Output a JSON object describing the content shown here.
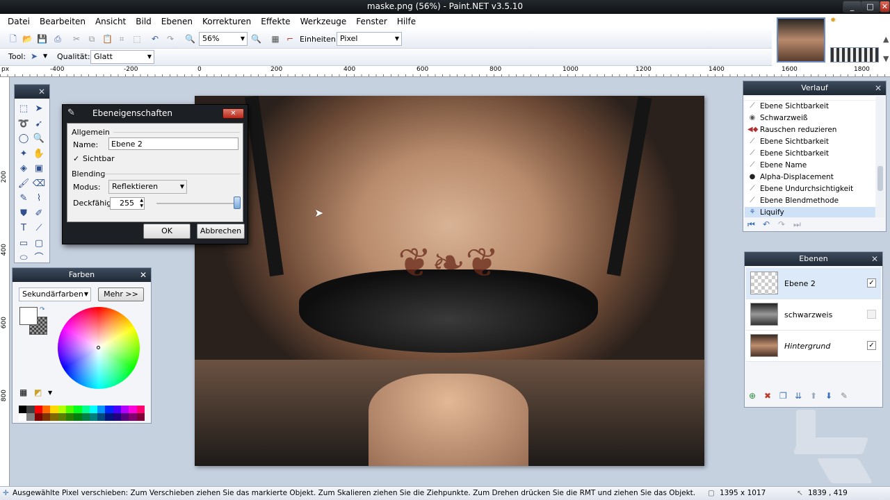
{
  "window": {
    "title": "maske.png (56%) - Paint.NET v3.5.10"
  },
  "menu": [
    "Datei",
    "Bearbeiten",
    "Ansicht",
    "Bild",
    "Ebenen",
    "Korrekturen",
    "Effekte",
    "Werkzeuge",
    "Fenster",
    "Hilfe"
  ],
  "toolbar": {
    "zoom_value": "56%",
    "units_label": "Einheiten:",
    "units_value": "Pixel",
    "tool_label": "Tool:",
    "quality_label": "Qualität:",
    "quality_value": "Glatt"
  },
  "ruler": {
    "unit": "px",
    "top_labels": [
      "-400",
      "-200",
      "0",
      "200",
      "400",
      "600",
      "800",
      "1000",
      "1200",
      "1400",
      "1600",
      "1800"
    ],
    "left_labels": [
      "200",
      "400",
      "600",
      "800"
    ]
  },
  "dialog": {
    "title": "Ebeneigenschaften",
    "section_general": "Allgemein",
    "name_label": "Name:",
    "name_value": "Ebene 2",
    "visible_label": "Sichtbar",
    "section_blending": "Blending",
    "mode_label": "Modus:",
    "mode_value": "Reflektieren",
    "opacity_label": "Deckfähigk",
    "opacity_value": "255",
    "ok_label": "OK",
    "cancel_label": "Abbrechen"
  },
  "farben": {
    "title": "Farben",
    "mode_value": "Sekundärfarben",
    "more_label": "Mehr >>"
  },
  "verlauf": {
    "title": "Verlauf",
    "items": [
      {
        "label": "Ebene Sichtbarkeit",
        "icon": "layer-visibility-icon"
      },
      {
        "label": "Schwarzweiß",
        "icon": "bw-icon"
      },
      {
        "label": "Rauschen reduzieren",
        "icon": "noise-icon"
      },
      {
        "label": "Ebene Sichtbarkeit",
        "icon": "layer-visibility-icon"
      },
      {
        "label": "Ebene Sichtbarkeit",
        "icon": "layer-visibility-icon"
      },
      {
        "label": "Ebene Name",
        "icon": "layer-name-icon"
      },
      {
        "label": "Alpha-Displacement",
        "icon": "alpha-icon"
      },
      {
        "label": "Ebene Undurchsichtigkeit",
        "icon": "opacity-icon"
      },
      {
        "label": "Ebene Blendmethode",
        "icon": "blend-icon"
      },
      {
        "label": "Liquify",
        "icon": "liquify-icon"
      }
    ]
  },
  "ebenen": {
    "title": "Ebenen",
    "layers": [
      {
        "name": "Ebene 2",
        "checked": true
      },
      {
        "name": "schwarzweis",
        "checked": false
      },
      {
        "name": "Hintergrund",
        "checked": true
      }
    ]
  },
  "status": {
    "message": "Ausgewählte Pixel verschieben: Zum Verschieben ziehen Sie das markierte Objekt. Zum Skalieren ziehen Sie die Ziehpunkte. Zum Drehen drücken Sie die RMT und ziehen Sie das Objekt.",
    "image_size": "1395 x 1017",
    "cursor_pos": "1839 , 419"
  },
  "colors": {
    "accent": "#3b6fb6",
    "title_bar": "#1a1f25",
    "close_red": "#c0392b",
    "workspace": "#c6d1e0"
  }
}
